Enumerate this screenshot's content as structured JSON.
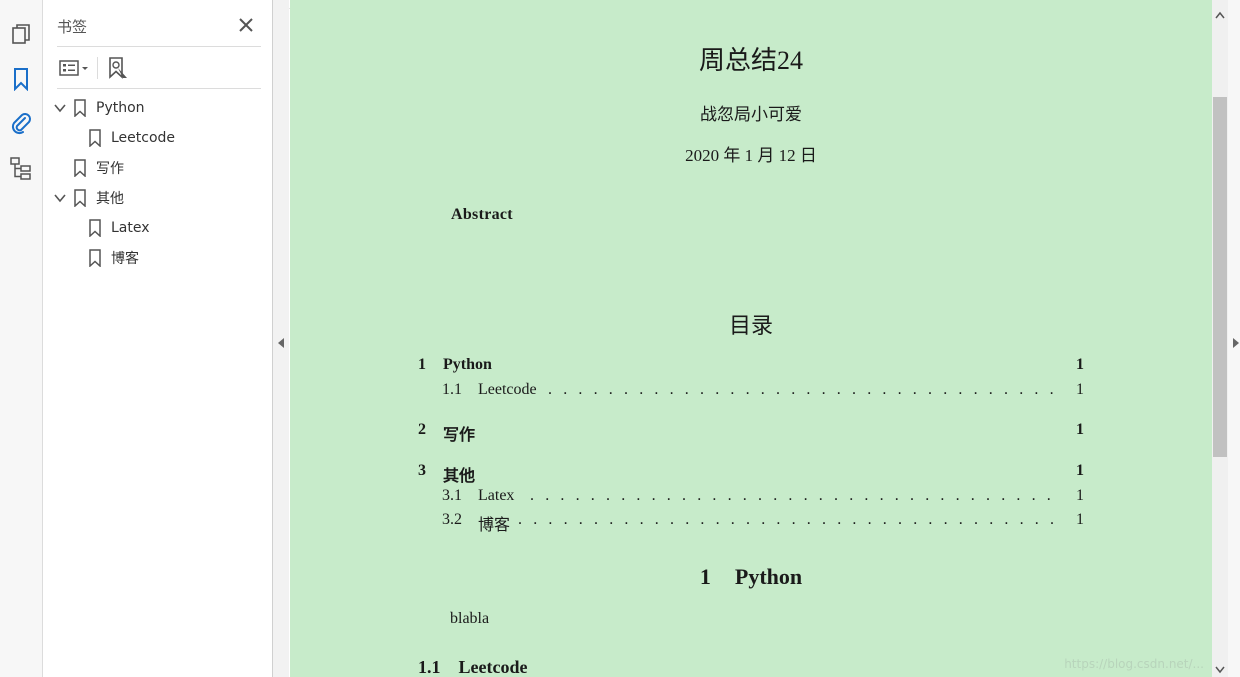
{
  "panel": {
    "title": "书签",
    "tree": [
      {
        "label": "Python",
        "expanded": true,
        "children": [
          {
            "label": "Leetcode"
          }
        ]
      },
      {
        "label": "写作"
      },
      {
        "label": "其他",
        "expanded": true,
        "children": [
          {
            "label": "Latex"
          },
          {
            "label": "博客"
          }
        ]
      }
    ]
  },
  "tools": [
    "page-thumbnails-icon",
    "bookmarks-icon",
    "attachments-icon",
    "structure-icon"
  ],
  "document": {
    "title": "周总结24",
    "author": "战忽局小可爱",
    "date": "2020 年 1 月 12 日",
    "abstract_heading": "Abstract",
    "toc_heading": "目录",
    "toc": [
      {
        "num": "1",
        "title": "Python",
        "page": "1",
        "level": 0
      },
      {
        "num": "1.1",
        "title": "Leetcode",
        "page": "1",
        "level": 1
      },
      {
        "num": "2",
        "title": "写作",
        "page": "1",
        "level": 0
      },
      {
        "num": "3",
        "title": "其他",
        "page": "1",
        "level": 0
      },
      {
        "num": "3.1",
        "title": "Latex",
        "page": "1",
        "level": 1
      },
      {
        "num": "3.2",
        "title": "博客",
        "page": "1",
        "level": 1
      }
    ],
    "section1": {
      "num": "1",
      "title": "Python"
    },
    "body": "blabla",
    "subsection1": {
      "num": "1.1",
      "title": "Leetcode"
    },
    "watermark": "https://blog.csdn.net/..."
  },
  "colors": {
    "page_background": "#c7ebca",
    "accent": "#1a6fc9"
  }
}
